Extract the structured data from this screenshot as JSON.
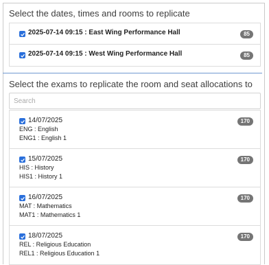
{
  "slots_section": {
    "heading": "Select the dates, times and rooms to replicate",
    "items": [
      {
        "label": "2025-07-14 09:15 : East Wing Performance Hall",
        "count": "85",
        "checked": true
      },
      {
        "label": "2025-07-14 09:15 : West Wing Performance Hall",
        "count": "85",
        "checked": true
      }
    ]
  },
  "exams_section": {
    "heading": "Select the exams to replicate the room and seat allocations to",
    "search_placeholder": "Search",
    "items": [
      {
        "date": "14/07/2025",
        "subject": "ENG : English",
        "unit": "ENG1 : English 1",
        "count": "170",
        "checked": true
      },
      {
        "date": "15/07/2025",
        "subject": "HIS : History",
        "unit": "HIS1 : History 1",
        "count": "170",
        "checked": true
      },
      {
        "date": "16/07/2025",
        "subject": "MAT : Mathematics",
        "unit": "MAT1 : Mathematics 1",
        "count": "170",
        "checked": true
      },
      {
        "date": "18/07/2025",
        "subject": "REL : Religious Education",
        "unit": "REL1 : Religious Education 1",
        "count": "170",
        "checked": true
      }
    ]
  },
  "colors": {
    "checkbox": "#2a6fdb",
    "badge": "#757575",
    "separator": "#6f98d0"
  }
}
